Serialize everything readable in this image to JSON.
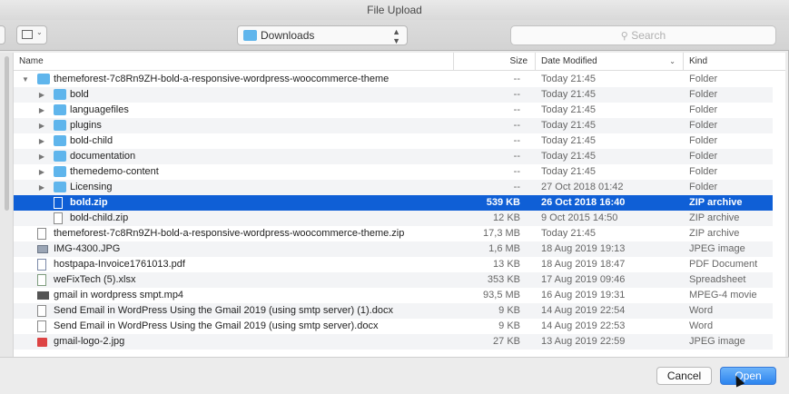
{
  "window": {
    "title": "File Upload"
  },
  "toolbar": {
    "location": "Downloads",
    "search_placeholder": "Search"
  },
  "columns": {
    "name": "Name",
    "size": "Size",
    "date": "Date Modified",
    "kind": "Kind"
  },
  "rows": [
    {
      "name": "themeforest-7c8Rn9ZH-bold-a-responsive-wordpress-woocommerce-theme",
      "size": "--",
      "date": "Today 21:45",
      "kind": "Folder",
      "icon": "folder-icon",
      "level": 0,
      "disclosure": "open"
    },
    {
      "name": "bold",
      "size": "--",
      "date": "Today 21:45",
      "kind": "Folder",
      "icon": "folder-icon",
      "level": 1,
      "disclosure": "closed"
    },
    {
      "name": "languagefiles",
      "size": "--",
      "date": "Today 21:45",
      "kind": "Folder",
      "icon": "folder-icon",
      "level": 1,
      "disclosure": "closed"
    },
    {
      "name": "plugins",
      "size": "--",
      "date": "Today 21:45",
      "kind": "Folder",
      "icon": "folder-icon",
      "level": 1,
      "disclosure": "closed"
    },
    {
      "name": "bold-child",
      "size": "--",
      "date": "Today 21:45",
      "kind": "Folder",
      "icon": "folder-icon",
      "level": 1,
      "disclosure": "closed"
    },
    {
      "name": "documentation",
      "size": "--",
      "date": "Today 21:45",
      "kind": "Folder",
      "icon": "folder-icon",
      "level": 1,
      "disclosure": "closed"
    },
    {
      "name": "themedemo-content",
      "size": "--",
      "date": "Today 21:45",
      "kind": "Folder",
      "icon": "folder-icon",
      "level": 1,
      "disclosure": "closed"
    },
    {
      "name": "Licensing",
      "size": "--",
      "date": "27 Oct 2018 01:42",
      "kind": "Folder",
      "icon": "folder-icon",
      "level": 1,
      "disclosure": "closed"
    },
    {
      "name": "bold.zip",
      "size": "539 KB",
      "date": "26 Oct 2018 16:40",
      "kind": "ZIP archive",
      "icon": "zip-file-icon",
      "level": 1,
      "disclosure": "none",
      "selected": true
    },
    {
      "name": "bold-child.zip",
      "size": "12 KB",
      "date": "9 Oct 2015 14:50",
      "kind": "ZIP archive",
      "icon": "zip-file-icon",
      "level": 1,
      "disclosure": "none"
    },
    {
      "name": "themeforest-7c8Rn9ZH-bold-a-responsive-wordpress-woocommerce-theme.zip",
      "size": "17,3 MB",
      "date": "Today 21:45",
      "kind": "ZIP archive",
      "icon": "zip-file-icon",
      "level": 0,
      "disclosure": "none"
    },
    {
      "name": "IMG-4300.JPG",
      "size": "1,6 MB",
      "date": "18 Aug 2019 19:13",
      "kind": "JPEG image",
      "icon": "image-file-icon",
      "level": 0,
      "disclosure": "none"
    },
    {
      "name": "hostpapa-Invoice1761013.pdf",
      "size": "13 KB",
      "date": "18 Aug 2019 18:47",
      "kind": "PDF Document",
      "icon": "pdf-file-icon",
      "level": 0,
      "disclosure": "none"
    },
    {
      "name": "weFixTech (5).xlsx",
      "size": "353 KB",
      "date": "17 Aug 2019 09:46",
      "kind": "Spreadsheet",
      "icon": "spreadsheet-file-icon",
      "level": 0,
      "disclosure": "none"
    },
    {
      "name": "gmail in wordpress smpt.mp4",
      "size": "93,5 MB",
      "date": "16 Aug 2019 19:31",
      "kind": "MPEG-4 movie",
      "icon": "video-file-icon",
      "level": 0,
      "disclosure": "none"
    },
    {
      "name": "Send Email in WordPress Using the Gmail 2019 (using smtp server) (1).docx",
      "size": "9 KB",
      "date": "14 Aug 2019 22:54",
      "kind": "Word",
      "icon": "document-file-icon",
      "level": 0,
      "disclosure": "none"
    },
    {
      "name": "Send Email in WordPress Using the Gmail 2019 (using smtp server).docx",
      "size": "9 KB",
      "date": "14 Aug 2019 22:53",
      "kind": "Word",
      "icon": "document-file-icon",
      "level": 0,
      "disclosure": "none"
    },
    {
      "name": "gmail-logo-2.jpg",
      "size": "27 KB",
      "date": "13 Aug 2019 22:59",
      "kind": "JPEG image",
      "icon": "jpeg-file-icon",
      "level": 0,
      "disclosure": "none"
    }
  ],
  "footer": {
    "cancel_label": "Cancel",
    "open_label": "Open"
  },
  "colors": {
    "selection": "#0f5fd6",
    "accent": "#2c84ee",
    "folder": "#5fb5ec"
  }
}
